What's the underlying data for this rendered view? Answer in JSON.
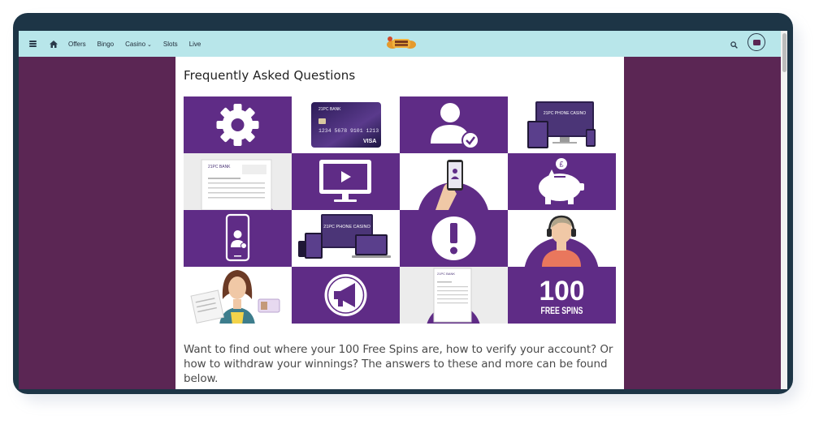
{
  "nav": {
    "links": [
      "Offers",
      "Bingo",
      "Casino",
      "Slots",
      "Live"
    ],
    "casino_chevron": "⌄"
  },
  "faq": {
    "title": "Frequently Asked Questions",
    "intro": "Want to find out where your 100 Free Spins are, how to verify your account? Or how to withdraw your winnings? The answers to these and more can be found below."
  },
  "tiles": [
    {
      "name": "tile-settings",
      "icon": "gear-icon"
    },
    {
      "name": "tile-bank-card",
      "icon": "credit-card-icon",
      "brand": "21PC BANK",
      "number": "1234 5678 9101 1213",
      "network": "VISA"
    },
    {
      "name": "tile-verified-user",
      "icon": "user-check-icon"
    },
    {
      "name": "tile-devices",
      "icon": "devices-icon",
      "brand": "21PC PHONE CASINO"
    },
    {
      "name": "tile-bank-statement",
      "icon": "bank-statement-icon",
      "brand": "21PC BANK"
    },
    {
      "name": "tile-video",
      "icon": "monitor-play-icon"
    },
    {
      "name": "tile-phone-hand",
      "icon": "phone-in-hand-icon"
    },
    {
      "name": "tile-savings",
      "icon": "piggy-bank-icon"
    },
    {
      "name": "tile-mobile-user",
      "icon": "mobile-user-icon"
    },
    {
      "name": "tile-phone-casino",
      "icon": "devices-icon",
      "brand": "21PC PHONE CASINO"
    },
    {
      "name": "tile-alert",
      "icon": "exclamation-icon"
    },
    {
      "name": "tile-support",
      "icon": "headset-agent-icon"
    },
    {
      "name": "tile-id-documents",
      "icon": "id-documents-icon"
    },
    {
      "name": "tile-announcements",
      "icon": "megaphone-icon"
    },
    {
      "name": "tile-invoice",
      "icon": "invoice-icon",
      "brand": "21PC BANK"
    },
    {
      "name": "tile-free-spins",
      "icon": "free-spins-badge",
      "line1": "100",
      "line2": "FREE SPINS"
    }
  ],
  "colors": {
    "purple": "#5f2c86",
    "page_bg": "#5b2654",
    "navbar": "#b8e6ea",
    "frame": "#1d3546"
  }
}
